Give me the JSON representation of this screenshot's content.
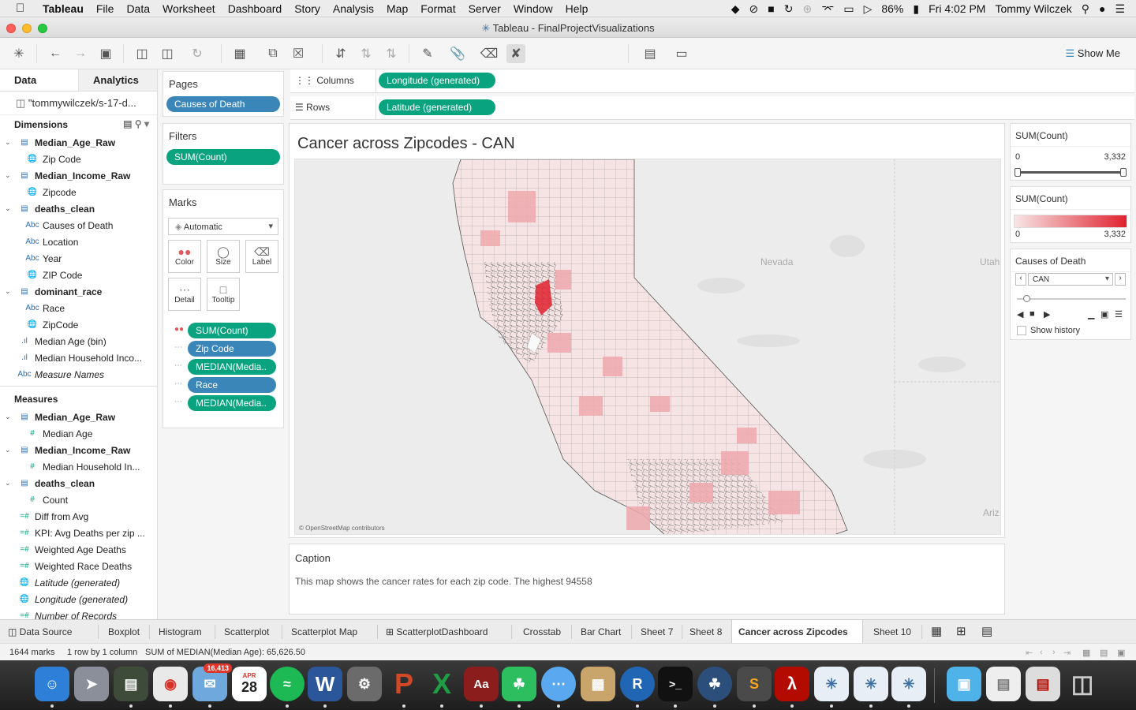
{
  "menubar": {
    "app": "Tableau",
    "menus": [
      "File",
      "Data",
      "Worksheet",
      "Dashboard",
      "Story",
      "Analysis",
      "Map",
      "Format",
      "Server",
      "Window",
      "Help"
    ],
    "battery": "86%",
    "clock": "Fri 4:02 PM",
    "user": "Tommy Wilczek"
  },
  "window": {
    "title": "Tableau - FinalProjectVisualizations"
  },
  "toolbar": {
    "show_me": "Show Me"
  },
  "datapane": {
    "tab_data": "Data",
    "tab_analytics": "Analytics",
    "source": "\"tommywilczek/s-17-d...",
    "dimensions_label": "Dimensions",
    "measures_label": "Measures",
    "dimensions": [
      {
        "label": "Median_Age_Raw",
        "type": "group"
      },
      {
        "label": "Zip Code",
        "type": "geo"
      },
      {
        "label": "Median_Income_Raw",
        "type": "group"
      },
      {
        "label": "Zipcode",
        "type": "geo"
      },
      {
        "label": "deaths_clean",
        "type": "group"
      },
      {
        "label": "Causes of Death",
        "type": "abc"
      },
      {
        "label": "Location",
        "type": "abc"
      },
      {
        "label": "Year",
        "type": "abc"
      },
      {
        "label": "ZIP Code",
        "type": "geo"
      },
      {
        "label": "dominant_race",
        "type": "group"
      },
      {
        "label": "Race",
        "type": "abc"
      },
      {
        "label": "ZipCode",
        "type": "geo"
      },
      {
        "label": "Median Age (bin)",
        "type": "bin"
      },
      {
        "label": "Median Household Inco...",
        "type": "bin"
      },
      {
        "label": "Measure Names",
        "type": "abc-italic"
      }
    ],
    "measures": [
      {
        "label": "Median_Age_Raw",
        "type": "group"
      },
      {
        "label": "Median Age",
        "type": "num"
      },
      {
        "label": "Median_Income_Raw",
        "type": "group"
      },
      {
        "label": "Median Household In...",
        "type": "num"
      },
      {
        "label": "deaths_clean",
        "type": "group"
      },
      {
        "label": "Count",
        "type": "num"
      },
      {
        "label": "Diff from Avg",
        "type": "calc"
      },
      {
        "label": "KPI: Avg Deaths per zip ...",
        "type": "calc"
      },
      {
        "label": "Weighted Age Deaths",
        "type": "calc"
      },
      {
        "label": "Weighted Race Deaths",
        "type": "calc"
      },
      {
        "label": "Latitude (generated)",
        "type": "geo-italic"
      },
      {
        "label": "Longitude (generated)",
        "type": "geo-italic"
      },
      {
        "label": "Number of Records",
        "type": "calc-italic"
      }
    ]
  },
  "pages": {
    "title": "Pages",
    "pill": "Causes of Death"
  },
  "filters": {
    "title": "Filters",
    "pill": "SUM(Count)"
  },
  "marks": {
    "title": "Marks",
    "type": "Automatic",
    "buttons": [
      "Color",
      "Size",
      "Label",
      "Detail",
      "Tooltip"
    ],
    "pills": [
      {
        "label": "SUM(Count)",
        "color": "green"
      },
      {
        "label": "Zip Code",
        "color": "blue"
      },
      {
        "label": "MEDIAN(Media..",
        "color": "green"
      },
      {
        "label": "Race",
        "color": "blue"
      },
      {
        "label": "MEDIAN(Media..",
        "color": "green"
      }
    ]
  },
  "shelves": {
    "columns_label": "Columns",
    "columns_pill": "Longitude (generated)",
    "rows_label": "Rows",
    "rows_pill": "Latitude (generated)"
  },
  "viz": {
    "title": "Cancer across Zipcodes - CAN",
    "map_labels": [
      "Nevada",
      "Utah",
      "Ariz"
    ],
    "attribution": "© OpenStreetMap contributors"
  },
  "caption": {
    "title": "Caption",
    "text": "This map shows the cancer rates for each zip code. The highest 94558"
  },
  "legends": {
    "filter_title": "SUM(Count)",
    "filter_min": "0",
    "filter_max": "3,332",
    "color_title": "SUM(Count)",
    "color_min": "0",
    "color_max": "3,332",
    "color_low": "#f7e6e6",
    "color_high": "#e0222f",
    "pages_title": "Causes of Death",
    "pages_value": "CAN",
    "show_history": "Show history"
  },
  "sheet_tabs": [
    "Data Source",
    "Boxplot",
    "Histogram",
    "Scatterplot",
    "Scatterplot Map",
    "ScatterplotDashboard",
    "Crosstab",
    "Bar Chart",
    "Sheet 7",
    "Sheet 8",
    "Cancer across Zipcodes",
    "Sheet 10"
  ],
  "active_tab": "Cancer across Zipcodes",
  "status": {
    "marks": "1644 marks",
    "dims": "1 row by 1 column",
    "agg": "SUM of MEDIAN(Median Age): 65,626.50"
  },
  "dock": {
    "mail_badge": "16,413",
    "calendar_month": "APR",
    "calendar_day": "28"
  }
}
